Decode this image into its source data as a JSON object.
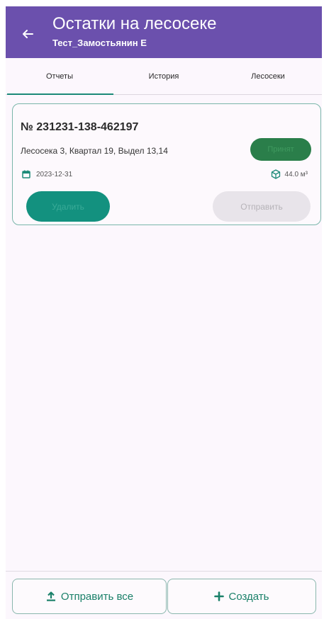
{
  "appbar": {
    "title": "Остатки на лесосеке",
    "subtitle": "Тест_Замостьянин Е",
    "back_icon": "arrow-left-icon",
    "color": "#6b50ad"
  },
  "tabs": [
    {
      "label": "Отчеты",
      "active": true
    },
    {
      "label": "История",
      "active": false
    },
    {
      "label": "Лесосеки",
      "active": false
    }
  ],
  "accent_color": "#1b8a78",
  "report_card": {
    "number": "№ 231231-138-462197",
    "location": "Лесосека 3, Квартал 19, Выдел 13,14",
    "status": "Принят",
    "date_icon": "calendar-icon",
    "date": "2023-12-31",
    "volume_icon": "cube-icon",
    "volume": "44.0 м³",
    "delete_label": "Удалить",
    "send_label": "Отправить"
  },
  "bottom": {
    "send_all_icon": "upload-icon",
    "send_all_label": "Отправить все",
    "create_icon": "plus-icon",
    "create_label": "Создать"
  }
}
